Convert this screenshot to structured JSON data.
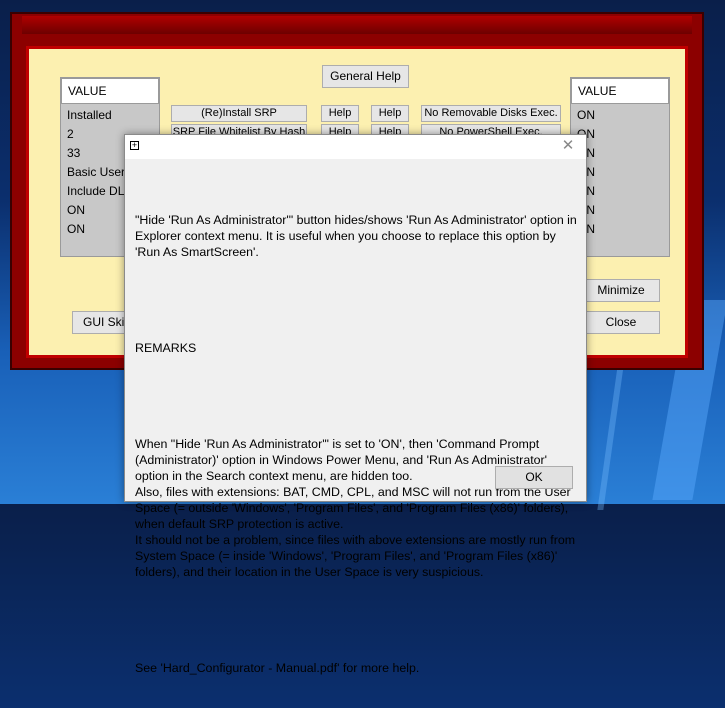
{
  "main": {
    "general_help": "General Help",
    "left_panel": {
      "header": "VALUE",
      "items": [
        "Installed",
        "2",
        "33",
        "Basic User",
        "Include DLL",
        "ON",
        "ON"
      ]
    },
    "right_panel": {
      "header": "VALUE",
      "items": [
        "ON",
        "ON",
        "ON",
        "ON",
        "ON",
        "ON",
        "ON"
      ]
    },
    "row1": {
      "action": "(Re)Install SRP",
      "help1": "Help",
      "help2": "Help",
      "option": "No Removable Disks Exec."
    },
    "row2": {
      "action": "SRP File Whitelist By Hash",
      "help1": "Help",
      "help2": "Help",
      "option": "No PowerShell Exec."
    },
    "gui_skin": "GUI Skin",
    "minimize": "Minimize",
    "close": "Close"
  },
  "dialog": {
    "icon": "app-icon",
    "close_icon": "close-icon",
    "paragraphs": [
      "\"Hide 'Run As Administrator'\" button hides/shows 'Run As Administrator' option in Explorer context menu. It is useful when you choose to replace this option by 'Run As SmartScreen'.",
      "REMARKS",
      "When \"Hide 'Run As Administrator'\" is set to 'ON', then 'Command Prompt (Administrator)' option in Windows Power Menu, and 'Run As Administrator' option in the Search context menu, are hidden too.\nAlso, files with extensions: BAT, CMD, CPL, and MSC will not run from the User Space (= outside 'Windows', 'Program Files', and 'Program Files (x86)' folders), when default SRP protection is active.\nIt should not be a problem, since files with above extensions are mostly run from System Space (= inside 'Windows', 'Program Files', and 'Program Files (x86)' folders), and their location in the User Space is very suspicious.",
      "See 'Hard_Configurator - Manual.pdf' for more help."
    ],
    "ok": "OK"
  }
}
